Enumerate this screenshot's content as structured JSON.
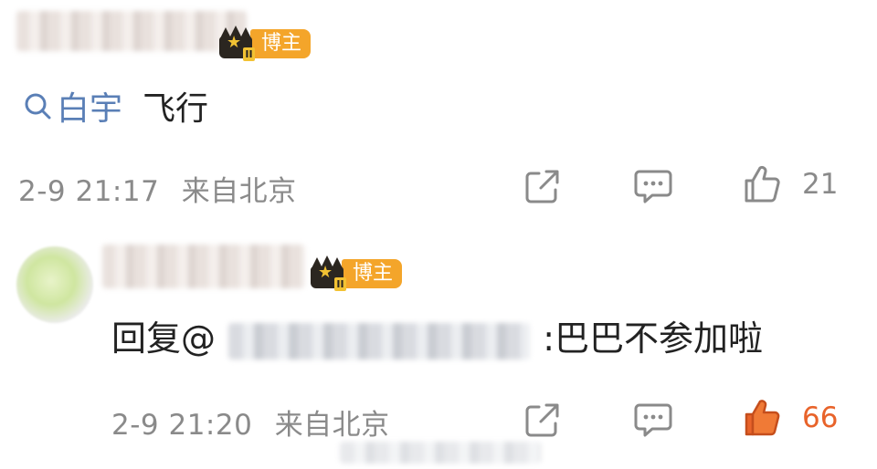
{
  "comments": [
    {
      "badge_label": "博主",
      "badge_level": "II",
      "search_link_text": "白宇",
      "body_text": "飞行",
      "time": "2-9 21:17",
      "location": "来自北京",
      "like_count": "21"
    },
    {
      "badge_label": "博主",
      "badge_level": "II",
      "reply_prefix": "回复@",
      "reply_text": ":巴巴不参加啦",
      "time": "2-9 21:20",
      "location": "来自北京",
      "like_count": "66"
    }
  ],
  "icons": {
    "share": "share-icon",
    "comment": "comment-icon",
    "like": "thumbs-up-icon",
    "search": "search-icon"
  },
  "colors": {
    "link": "#5a7fb6",
    "badge": "#f4a52a",
    "liked": "#e8632a",
    "muted": "#8a8a8a"
  }
}
